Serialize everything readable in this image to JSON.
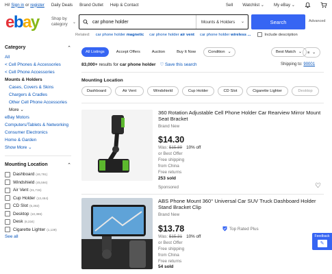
{
  "topbar": {
    "greeting": "Hi!",
    "sign_in": "Sign in",
    "or": "or",
    "register": "register",
    "links": [
      "Daily Deals",
      "Brand Outlet",
      "Help & Contact"
    ],
    "sell": "Sell",
    "watchlist": "Watchlist",
    "my_ebay": "My eBay"
  },
  "header": {
    "logo": [
      "e",
      "b",
      "a",
      "y"
    ],
    "shop_by_1": "Shop by",
    "shop_by_2": "category",
    "search_value": "car phone holder",
    "search_category": "Mounts & Holders",
    "search_button": "Search",
    "advanced": "Advanced"
  },
  "related": {
    "label": "Related:",
    "items": [
      {
        "plain": "car phone holder ",
        "bold": "magnetic"
      },
      {
        "plain": "car phone holder ",
        "bold": "air vent"
      },
      {
        "plain": "car phone holder ",
        "bold": "wireless ..."
      }
    ],
    "include_desc": "Include description"
  },
  "sidebar": {
    "category_header": "Category",
    "categories": [
      {
        "label": "All",
        "style": "link"
      },
      {
        "label": "< Cell Phones & Accessories",
        "style": "link"
      },
      {
        "label": "< Cell Phone Accessories",
        "style": "link"
      },
      {
        "label": "Mounts & Holders",
        "style": "active"
      },
      {
        "label": "Cases, Covers & Skins",
        "style": "link-ind"
      },
      {
        "label": "Chargers & Cradles",
        "style": "link-ind"
      },
      {
        "label": "Other Cell Phone Accessories",
        "style": "link-ind"
      },
      {
        "label": "More ⌄",
        "style": "muted-ind"
      },
      {
        "label": "eBay Motors",
        "style": "link"
      },
      {
        "label": "Computers/Tablets & Networking",
        "style": "link"
      },
      {
        "label": "Consumer Electronics",
        "style": "link"
      },
      {
        "label": "Home & Garden",
        "style": "link"
      },
      {
        "label": "Show More ⌄",
        "style": "link"
      }
    ],
    "mounting_header": "Mounting Location",
    "mounting": [
      {
        "label": "Dashboard",
        "count": "(46,791)"
      },
      {
        "label": "Windshield",
        "count": "(45,594)"
      },
      {
        "label": "Air Vent",
        "count": "(31,715)"
      },
      {
        "label": "Cup Holder",
        "count": "(13,464)"
      },
      {
        "label": "CD Slot",
        "count": "(5,282)"
      },
      {
        "label": "Desktop",
        "count": "(10,386)"
      },
      {
        "label": "Desk",
        "count": "(8,334)"
      },
      {
        "label": "Cigarette Lighter",
        "count": "(1,139)"
      }
    ],
    "see_all": "See all"
  },
  "main": {
    "tabs": [
      "All Listings",
      "Accept Offers",
      "Auction",
      "Buy It Now"
    ],
    "condition": "Condition",
    "sort": "Best Match",
    "results_count": "83,000+",
    "results_mid": " results for ",
    "results_query": "car phone holder",
    "save_search": "Save this search",
    "ship_to_label": "Shipping to:",
    "ship_to_zip": "90001",
    "mounting_title": "Mounting Location",
    "chips": [
      "Dashboard",
      "Air Vent",
      "Windshield",
      "Cup Holder",
      "CD Slot",
      "Cigarette Lighter",
      "Desktop"
    ]
  },
  "items": [
    {
      "title": "360 Rotation Adjustable Cell Phone Holder Car Rearview Mirror Mount Seat Bracket",
      "condition": "Brand New",
      "price": "$14.30",
      "was_label": "Was: ",
      "was_price": "$15.89",
      "off": "10% off",
      "offer": "or Best Offer",
      "shipping": "Free shipping",
      "from": "from China",
      "returns": "Free returns",
      "sold": "253 sold",
      "sponsored": "Sponsored"
    },
    {
      "title": "ABS Phone Mount 360° Universal Car SUV Truck Dashboard Holder Stand Bracket Clip",
      "condition": "Brand New",
      "price": "$13.78",
      "was_label": "Was: ",
      "was_price": "$15.31",
      "off": "10% off",
      "offer": "or Best Offer",
      "shipping": "Free shipping",
      "from": "from China",
      "returns": "Free returns",
      "sold": "54 sold",
      "badge": "Top Rated Plus"
    }
  ],
  "feedback": "Feedback",
  "colors": {
    "accent": "#3665f3",
    "link": "#0654ba",
    "text": "#191919",
    "muted": "#707070"
  }
}
